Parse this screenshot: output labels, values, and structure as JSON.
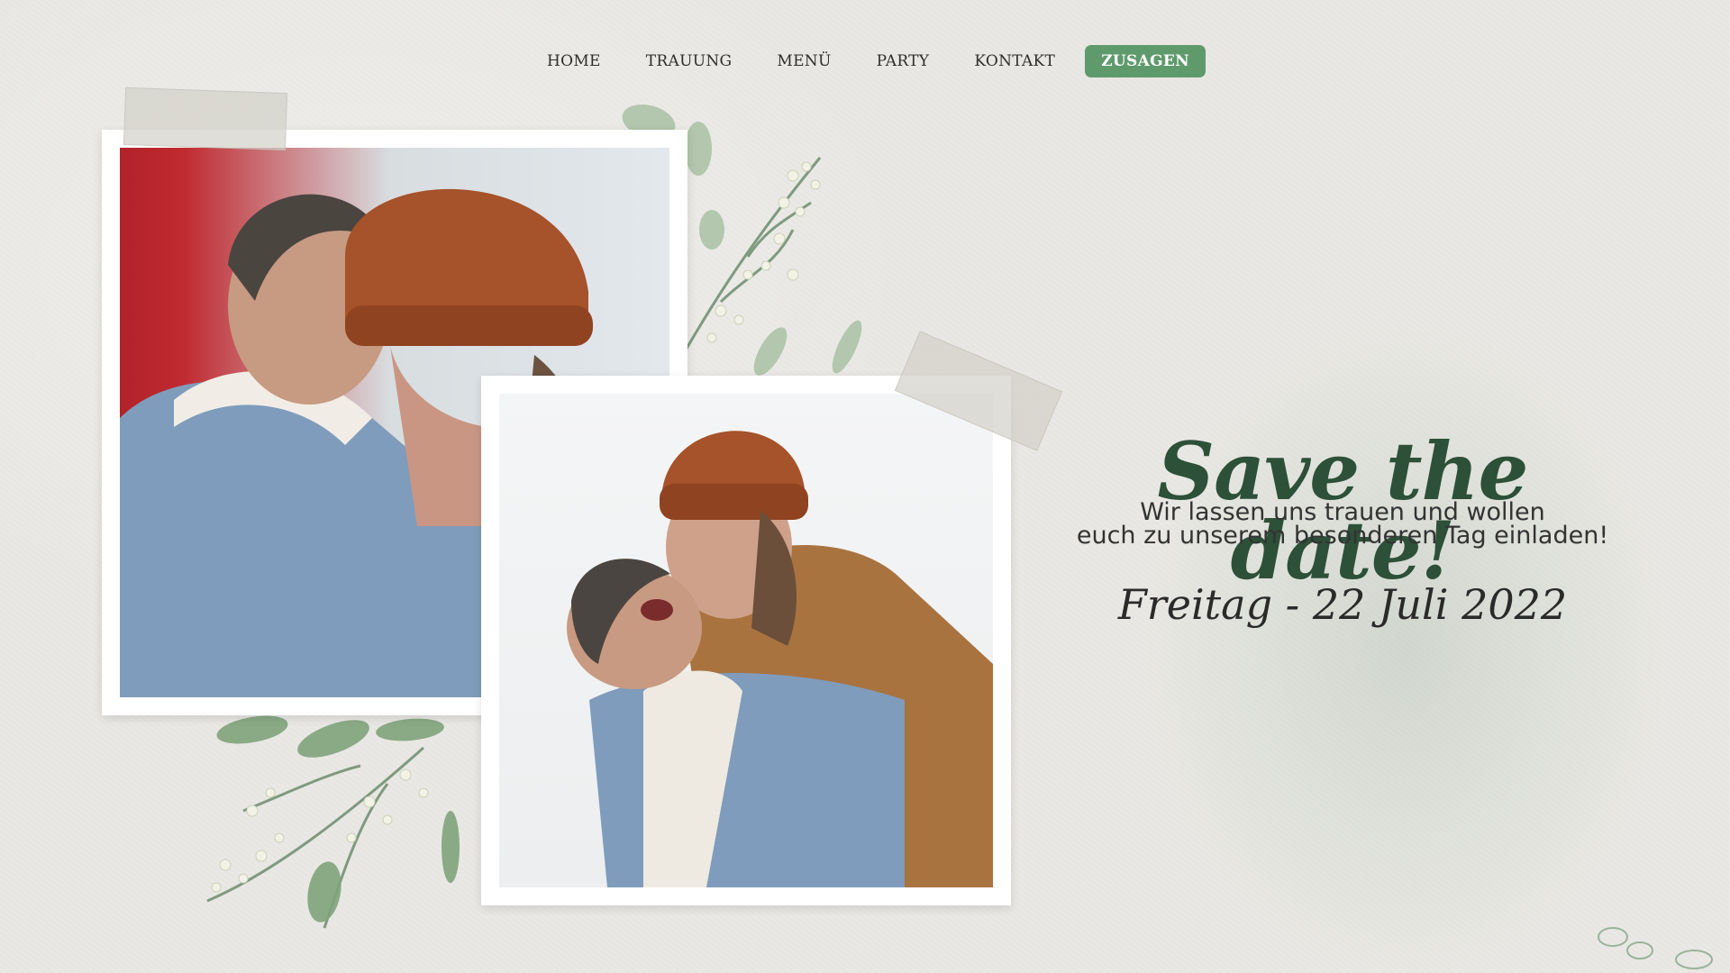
{
  "nav": {
    "items": [
      {
        "label": "HOME"
      },
      {
        "label": "TRAUUNG"
      },
      {
        "label": "MENÜ"
      },
      {
        "label": "PARTY"
      },
      {
        "label": "KONTAKT"
      }
    ],
    "cta_label": "ZUSAGEN"
  },
  "hero": {
    "headline": "Save the date!",
    "subtext_line1": "Wir lassen uns trauen und wollen",
    "subtext_line2": "euch zu unserem besonderen Tag einladen!",
    "date": "Freitag - 22 Juli 2022"
  },
  "colors": {
    "accent": "#5f9a6c",
    "headline": "#2d5038",
    "background": "#e9e8e4"
  }
}
